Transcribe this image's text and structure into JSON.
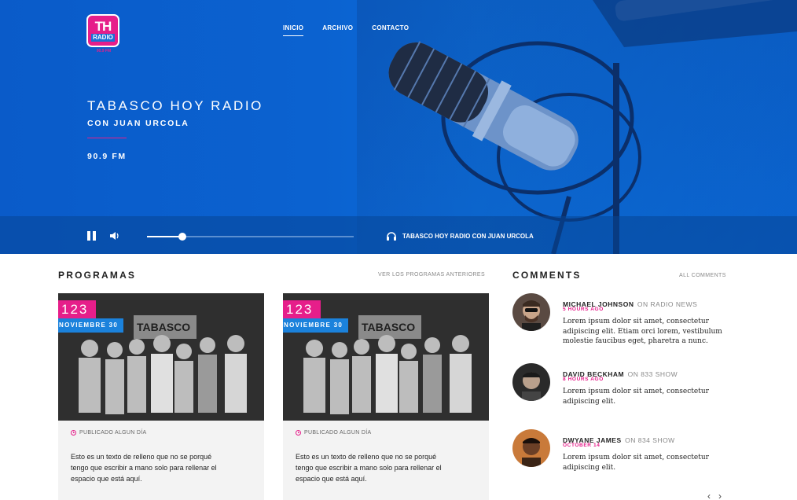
{
  "logo": {
    "line1": "TH",
    "line2": "RADIO",
    "line3": "90.9 FM"
  },
  "nav": {
    "items": [
      {
        "label": "INICIO",
        "active": true
      },
      {
        "label": "ARCHIVO",
        "active": false
      },
      {
        "label": "CONTACTO",
        "active": false
      }
    ]
  },
  "hero": {
    "title": "TABASCO HOY RADIO",
    "subtitle": "CON JUAN URCOLA",
    "frequency": "90.9 FM"
  },
  "player": {
    "progress": 0.17,
    "now_playing": "TABASCO HOY RADIO CON JUAN URCOLA"
  },
  "programs": {
    "title": "PROGRAMAS",
    "link": "VER LOS PROGRAMAS ANTERIORES",
    "cards": [
      {
        "number": "123",
        "date": "NOVIEMBRE 30",
        "photo_sign": "TABASCO",
        "meta": "PUBLICADO ALGUN DÍA",
        "body": "Esto es un texto de relleno que no se porqué tengo que escribir a mano solo para rellenar el espacio que está aquí."
      },
      {
        "number": "123",
        "date": "NOVIEMBRE 30",
        "photo_sign": "TABASCO",
        "meta": "PUBLICADO ALGUN DÍA",
        "body": "Esto es un texto de relleno que no se porqué tengo que escribir a mano solo para rellenar el espacio que está aquí."
      }
    ]
  },
  "comments": {
    "title": "COMMENTS",
    "link": "ALL COMMENTS",
    "items": [
      {
        "name": "MICHAEL JOHNSON",
        "show": "ON RADIO NEWS",
        "time": "5 HOURS AGO",
        "text": "Lorem ipsum dolor sit amet, consectetur adipiscing elit. Etiam orci lorem, vestibulum molestie faucibus eget, pharetra a nunc."
      },
      {
        "name": "DAVID BECKHAM",
        "show": "ON 833 SHOW",
        "time": "8 HOURS AGO",
        "text": "Lorem ipsum dolor sit amet, consectetur adipiscing elit."
      },
      {
        "name": "DWYANE JAMES",
        "show": "ON 834 SHOW",
        "time": "OCTOBER 14",
        "text": "Lorem ipsum dolor sit amet, consectetur adipiscing elit."
      }
    ]
  },
  "colors": {
    "hero_blue": "#0b62d0",
    "accent_pink": "#e61e8a",
    "date_blue": "#1b82dc"
  }
}
